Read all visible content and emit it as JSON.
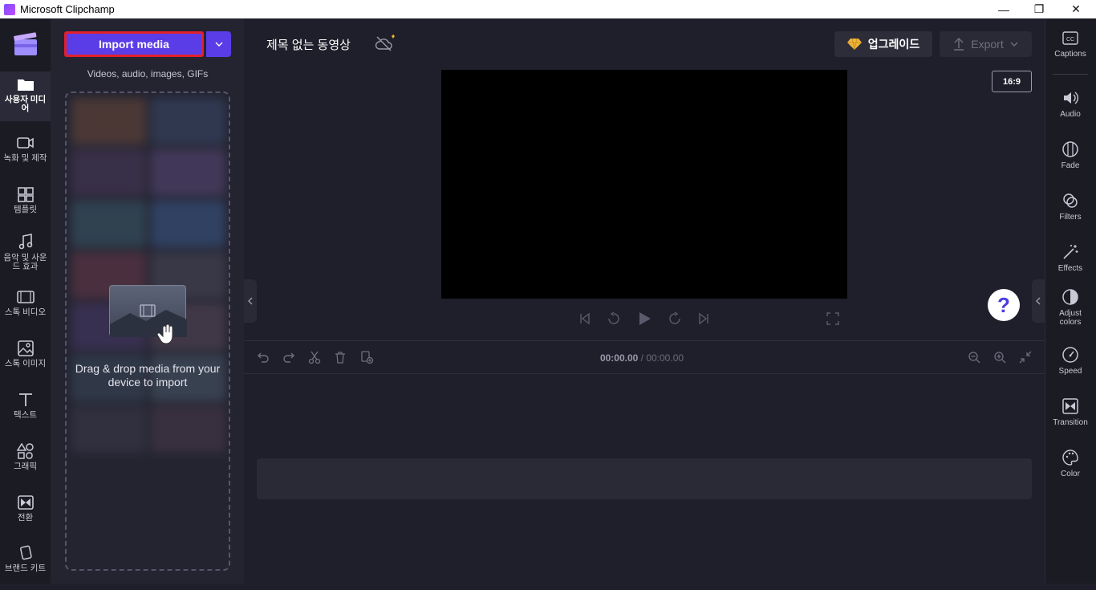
{
  "window": {
    "title": "Microsoft Clipchamp",
    "minimize": "—",
    "maximize": "❐",
    "close": "✕"
  },
  "left_rail": [
    {
      "label": "사용자 미디어",
      "icon": "folder-icon"
    },
    {
      "label": "녹화 및 제작",
      "icon": "camera-icon"
    },
    {
      "label": "템플릿",
      "icon": "templates-icon"
    },
    {
      "label": "음악 및 사운드 효과",
      "icon": "music-icon"
    },
    {
      "label": "스톡 비디오",
      "icon": "film-icon"
    },
    {
      "label": "스톡 이미지",
      "icon": "image-icon"
    },
    {
      "label": "텍스트",
      "icon": "text-icon"
    },
    {
      "label": "그래픽",
      "icon": "shapes-icon"
    },
    {
      "label": "전환",
      "icon": "transition-icon"
    },
    {
      "label": "브랜드 키트",
      "icon": "brand-kit-icon"
    }
  ],
  "media_panel": {
    "import_label": "Import media",
    "import_sub": "Videos, audio, images, GIFs",
    "drop_text": "Drag & drop media from your device to import"
  },
  "header": {
    "project_title": "제목 없는 동영상",
    "upgrade_label": "업그레이드",
    "export_label": "Export"
  },
  "preview": {
    "aspect_ratio": "16:9"
  },
  "timeline": {
    "current": "00:00.00",
    "total": "/ 00:00.00"
  },
  "right_rail": [
    {
      "label": "Captions",
      "icon": "captions-icon"
    },
    {
      "label": "Audio",
      "icon": "speaker-icon"
    },
    {
      "label": "Fade",
      "icon": "fade-icon"
    },
    {
      "label": "Filters",
      "icon": "filters-icon"
    },
    {
      "label": "Effects",
      "icon": "magic-wand-icon"
    },
    {
      "label": "Adjust colors",
      "icon": "adjust-colors-icon"
    },
    {
      "label": "Speed",
      "icon": "speedometer-icon"
    },
    {
      "label": "Transition",
      "icon": "transition-icon"
    },
    {
      "label": "Color",
      "icon": "palette-icon"
    }
  ],
  "colors": {
    "accent": "#5b3de8",
    "highlight_border": "#e2202b",
    "background": "#1f1f2b"
  }
}
